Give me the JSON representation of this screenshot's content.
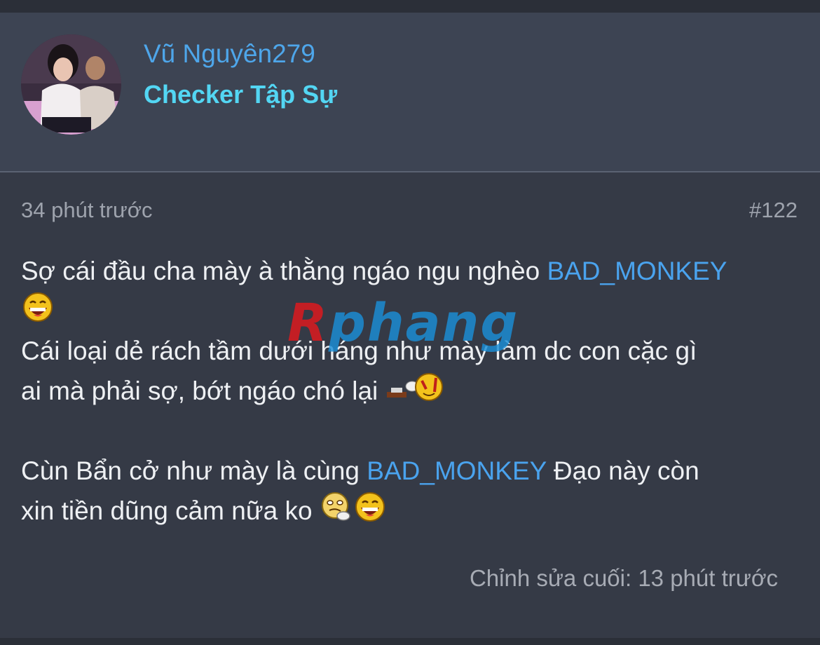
{
  "user": {
    "name": "Vũ Nguyên279",
    "title": "Checker Tập Sự"
  },
  "post": {
    "time": "34 phút trước",
    "number": "#122",
    "lines": [
      {
        "parts": [
          {
            "text": "Sợ cái đầu cha mày à thằng ngáo ngu nghèo ",
            "type": "text"
          },
          {
            "text": "BAD_MONKEY",
            "type": "mention"
          }
        ]
      },
      {
        "parts": [
          {
            "text": "",
            "type": "smiley",
            "icon": "laughing-smiley-icon"
          }
        ]
      },
      {
        "parts": [
          {
            "text": "Cái loại dẻ rách tầm dưới háng như mày làm dc con cặc gì",
            "type": "text"
          }
        ]
      },
      {
        "parts": [
          {
            "text": "ai mà phải sợ, bớt ngáo chó lại ",
            "type": "text"
          },
          {
            "text": "",
            "type": "smiley",
            "icon": "toilet-smiley-icon"
          }
        ]
      },
      {
        "gap": true
      },
      {
        "parts": [
          {
            "text": "Cùn Bẩn cở như mày là cùng ",
            "type": "text"
          },
          {
            "text": "BAD_MONKEY",
            "type": "mention"
          },
          {
            "text": " Đạo này còn",
            "type": "text"
          }
        ]
      },
      {
        "parts": [
          {
            "text": "xin tiền dũng cảm nữa ko ",
            "type": "text"
          },
          {
            "text": "",
            "type": "smiley",
            "icon": "thinking-smiley-icon"
          },
          {
            "text": "",
            "type": "smiley",
            "icon": "laughing-smiley-icon"
          }
        ]
      }
    ],
    "edited": "Chỉnh sửa cuối: 13 phút trước"
  },
  "watermark": {
    "part1": "R",
    "part2": "phang"
  },
  "colors": {
    "background": "#353a46",
    "header": "#3d4453",
    "mention": "#4aa3ee",
    "username": "#4ea6ea",
    "usertitle": "#53d6f3"
  }
}
